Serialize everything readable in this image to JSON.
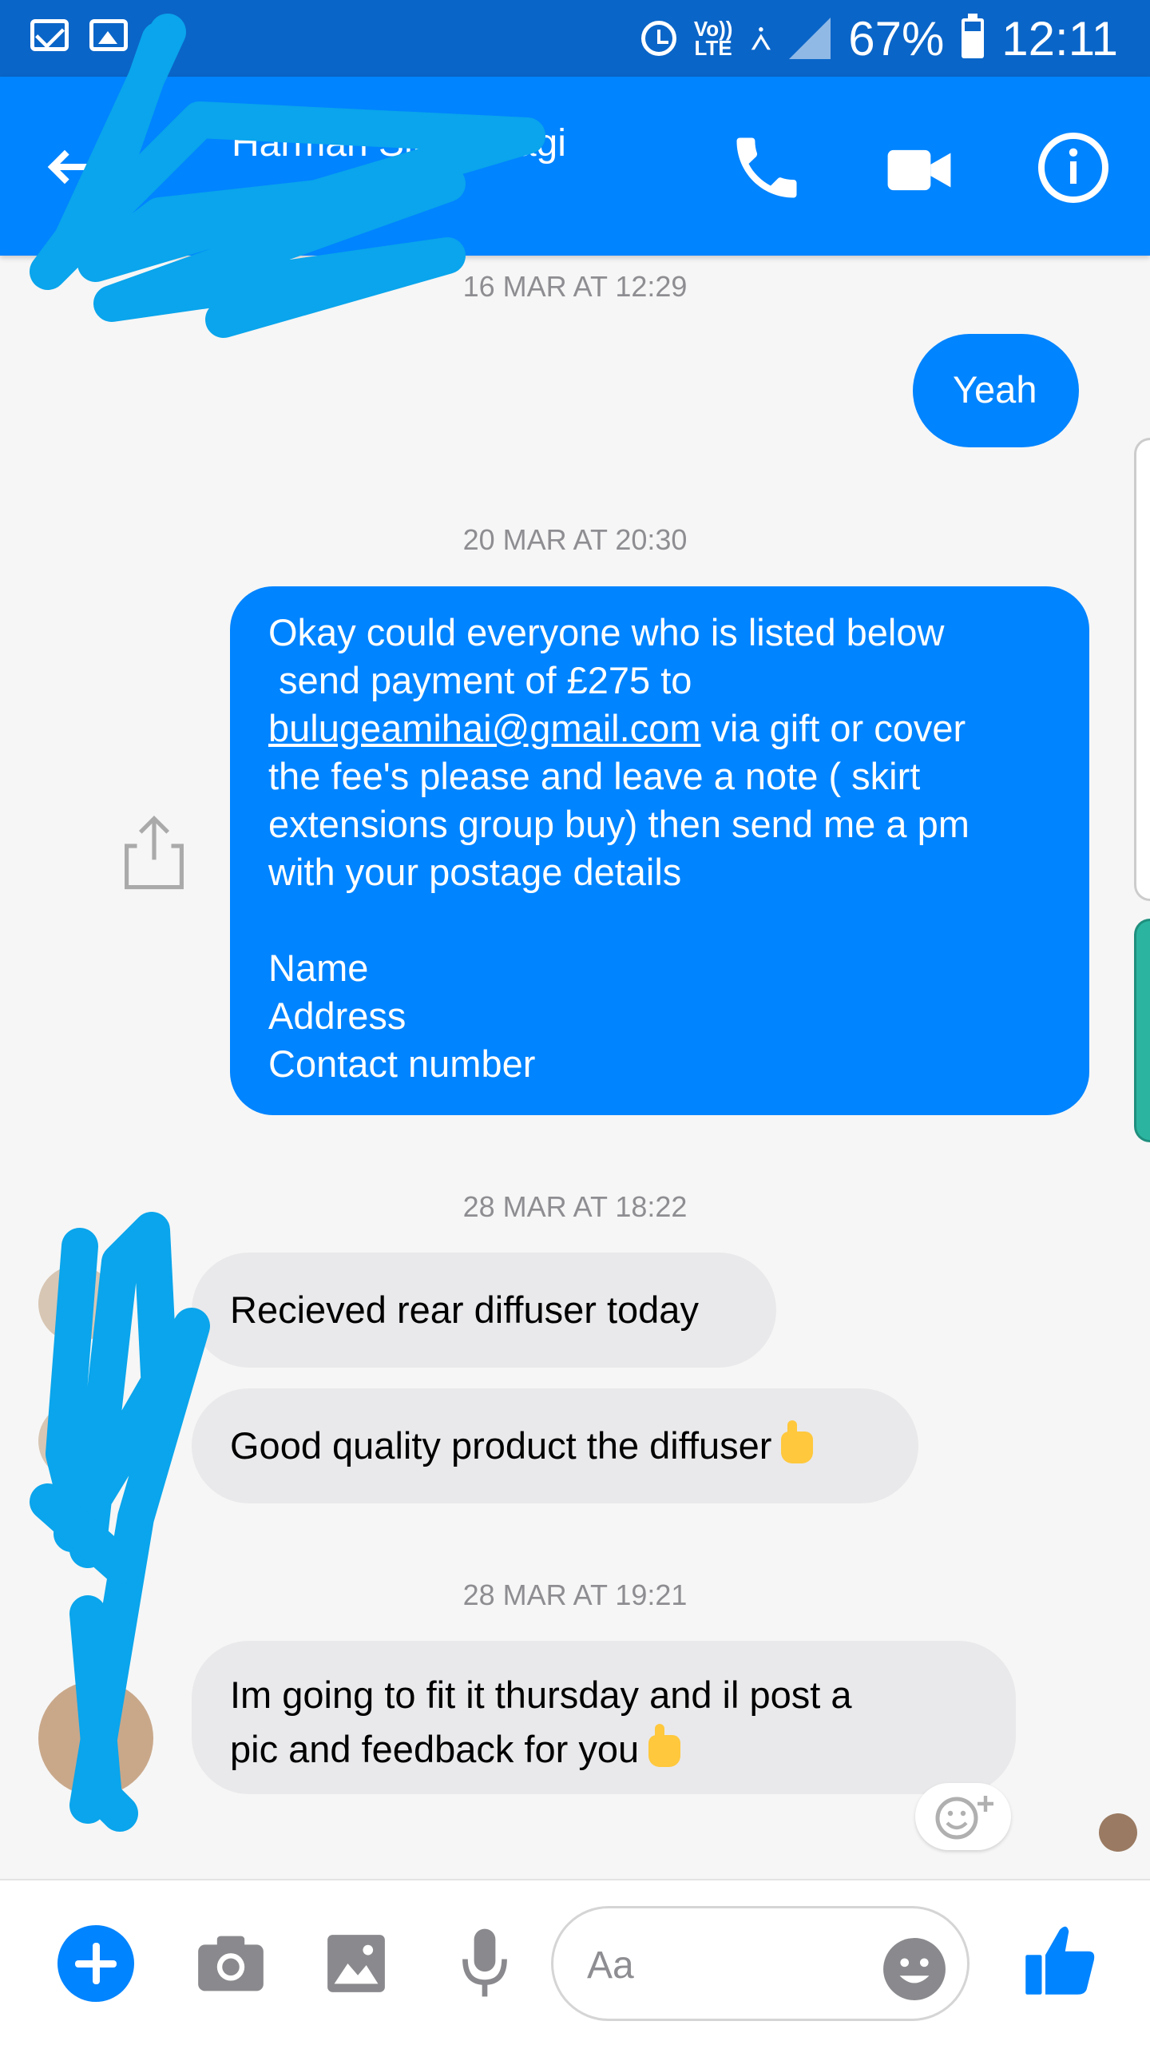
{
  "status_bar": {
    "lte_label_top": "Vo))",
    "lte_label_bottom": "LTE",
    "battery": "67%",
    "time": "12:11"
  },
  "header": {
    "contact_name": "Harman Singh Nagi"
  },
  "messages": [
    {
      "type": "timestamp",
      "text": "16 MAR AT 12:29"
    },
    {
      "type": "outgoing",
      "lines": [
        "Yeah"
      ]
    },
    {
      "type": "timestamp",
      "text": "20 MAR AT 20:30"
    },
    {
      "type": "outgoing",
      "lines": [
        "Okay could everyone who is listed below",
        " send payment of £275 to",
        "the fee's please and leave a note ( skirt",
        "extensions group buy) then send me a pm",
        "with your postage details",
        "",
        "Name",
        "Address",
        "Contact number"
      ],
      "email": "bulugeamihai@gmail.com",
      "after_email": " via gift or cover"
    },
    {
      "type": "timestamp",
      "text": "28 MAR AT 18:22"
    },
    {
      "type": "incoming",
      "lines": [
        "Recieved rear diffuser today"
      ]
    },
    {
      "type": "incoming",
      "lines": [
        "Good quality product the diffuser"
      ]
    },
    {
      "type": "timestamp",
      "text": "28 MAR AT 19:21"
    },
    {
      "type": "incoming",
      "lines": [
        "Im going to fit it thursday and il post a",
        "pic and feedback for you"
      ]
    }
  ],
  "composer": {
    "placeholder": "Aa"
  },
  "colors": {
    "status_bar": "#0a65c8",
    "header": "#0084ff",
    "outgoing_bubble": "#0084ff",
    "incoming_bubble": "#e9e9eb",
    "scribble": "#0aa5ec"
  },
  "icons": [
    "mail-icon",
    "image-icon",
    "alarm-icon",
    "wifi-icon",
    "signal-icon",
    "battery-icon",
    "back-arrow-icon",
    "phone-icon",
    "video-camera-icon",
    "info-icon",
    "share-icon",
    "add-reaction-icon",
    "plus-icon",
    "camera-icon",
    "gallery-icon",
    "microphone-icon",
    "emoji-icon",
    "thumbs-up-icon"
  ]
}
